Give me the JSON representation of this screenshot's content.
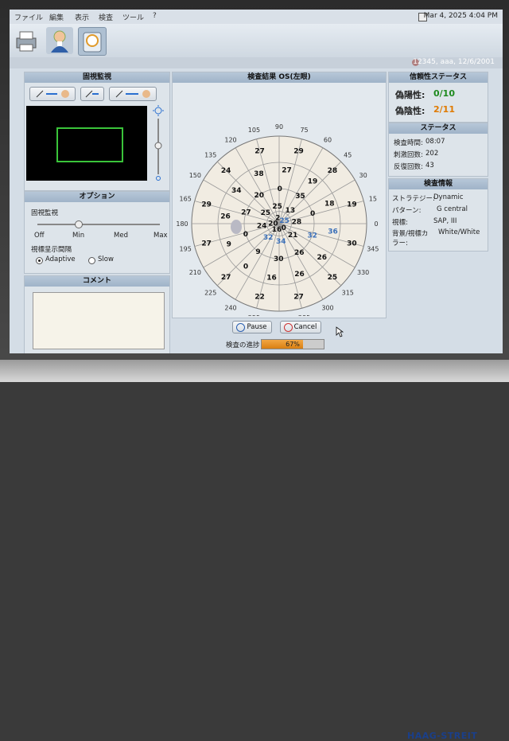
{
  "menubar": {
    "items": [
      "ファイル",
      "編集",
      "表示",
      "検査",
      "ツール",
      "?"
    ],
    "datetime": "Mar 4, 2025 4:04 PM"
  },
  "patient": {
    "info": "12345, aaa, 12/6/2001"
  },
  "fixation": {
    "title": "固視監視",
    "icons": [
      "fixation-left-icon",
      "fixation-center-icon",
      "fixation-right-icon"
    ]
  },
  "options": {
    "title": "オプション",
    "fixation_label": "固視監視",
    "slider_ticks": [
      "Off",
      "Min",
      "Med",
      "Max"
    ],
    "slider_value": "Min",
    "interval_label": "視標呈示間隔",
    "radio_adaptive": "Adaptive",
    "radio_slow": "Slow",
    "selected": "Adaptive"
  },
  "comment": {
    "title": "コメント",
    "text": ""
  },
  "results": {
    "title": "検査結果 OS(左眼)",
    "angle_labels": [
      "90",
      "75",
      "60",
      "45",
      "30",
      "15",
      "0",
      "345",
      "330",
      "315",
      "300",
      "285",
      "270",
      "255",
      "240",
      "225",
      "210",
      "195",
      "180",
      "165",
      "150",
      "135",
      "120",
      "105"
    ],
    "values": [
      {
        "v": "29",
        "c": "black"
      },
      {
        "v": "28",
        "c": "black"
      },
      {
        "v": "19",
        "c": "black"
      },
      {
        "v": "30",
        "c": "black"
      },
      {
        "v": "25",
        "c": "black"
      },
      {
        "v": "27",
        "c": "black"
      },
      {
        "v": "22",
        "c": "black"
      },
      {
        "v": "27",
        "c": "black"
      },
      {
        "v": "27",
        "c": "black"
      },
      {
        "v": "29",
        "c": "black"
      },
      {
        "v": "24",
        "c": "black"
      },
      {
        "v": "27",
        "c": "black"
      },
      {
        "v": "27",
        "c": "black"
      },
      {
        "v": "19",
        "c": "black"
      },
      {
        "v": "18",
        "c": "black"
      },
      {
        "v": "36",
        "c": "blue"
      },
      {
        "v": "26",
        "c": "black"
      },
      {
        "v": "26",
        "c": "black"
      },
      {
        "v": "16",
        "c": "black"
      },
      {
        "v": "0",
        "c": "black"
      },
      {
        "v": "9",
        "c": "black"
      },
      {
        "v": "26",
        "c": "black"
      },
      {
        "v": "34",
        "c": "black"
      },
      {
        "v": "38",
        "c": "black"
      },
      {
        "v": "0",
        "c": "black"
      },
      {
        "v": "35",
        "c": "black"
      },
      {
        "v": "0",
        "c": "black"
      },
      {
        "v": "32",
        "c": "blue"
      },
      {
        "v": "26",
        "c": "black"
      },
      {
        "v": "30",
        "c": "black"
      },
      {
        "v": "9",
        "c": "black"
      },
      {
        "v": "0",
        "c": "black"
      },
      {
        "v": "27",
        "c": "black"
      },
      {
        "v": "20",
        "c": "black"
      },
      {
        "v": "25",
        "c": "black"
      },
      {
        "v": "13",
        "c": "black"
      },
      {
        "v": "28",
        "c": "black"
      },
      {
        "v": "21",
        "c": "black"
      },
      {
        "v": "34",
        "c": "blue"
      },
      {
        "v": "32",
        "c": "blue"
      },
      {
        "v": "24",
        "c": "black"
      },
      {
        "v": "25",
        "c": "black"
      },
      {
        "v": "2",
        "c": "black"
      },
      {
        "v": "25",
        "c": "blue"
      },
      {
        "v": "0",
        "c": "black"
      },
      {
        "v": "16",
        "c": "black"
      },
      {
        "v": "20",
        "c": "black"
      }
    ]
  },
  "reliability": {
    "title": "信頼性ステータス",
    "false_pos_label": "偽陽性:",
    "false_pos_value": "0/10",
    "false_neg_label": "偽陰性:",
    "false_neg_value": "2/11",
    "colors": {
      "false_pos": "#1e8a1e",
      "false_neg": "#e07a00"
    }
  },
  "status": {
    "title": "ステータス",
    "rows": [
      {
        "label": "検査時間:",
        "value": "08:07"
      },
      {
        "label": "刺激回数:",
        "value": "202"
      },
      {
        "label": "反復回数:",
        "value": "43"
      }
    ]
  },
  "exam_info": {
    "title": "検査情報",
    "rows": [
      {
        "label": "ストラテジー:",
        "value": "Dynamic"
      },
      {
        "label": "パターン:",
        "value": "G central"
      },
      {
        "label": "視標:",
        "value": "SAP, III"
      },
      {
        "label": "背景/視標カ",
        "value": "White/White"
      },
      {
        "label": "ラー:",
        "value": ""
      }
    ]
  },
  "buttons": {
    "pause": "Pause",
    "cancel": "Cancel"
  },
  "progress": {
    "label": "検査の進捗",
    "value": 67,
    "text": "67%"
  },
  "brand": "HAAG-STREIT"
}
